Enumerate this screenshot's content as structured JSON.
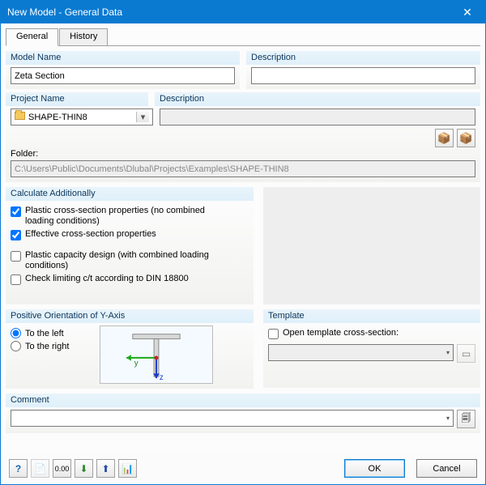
{
  "window": {
    "title": "New Model - General Data"
  },
  "tabs": {
    "general": "General",
    "history": "History"
  },
  "model": {
    "name_label": "Model Name",
    "name_value": "Zeta Section",
    "desc_label": "Description",
    "desc_value": ""
  },
  "project": {
    "name_label": "Project Name",
    "name_value": "SHAPE-THIN8",
    "desc_label": "Description",
    "desc_value": "",
    "folder_label": "Folder:",
    "folder_value": "C:\\Users\\Public\\Documents\\Dlubal\\Projects\\Examples\\SHAPE-THIN8"
  },
  "calc": {
    "header": "Calculate Additionally",
    "opt1": "Plastic cross-section properties (no combined loading conditions)",
    "opt2": "Effective cross-section properties",
    "opt3": "Plastic capacity design (with combined loading conditions)",
    "opt4": "Check limiting c/t according to DIN 18800"
  },
  "axis": {
    "header": "Positive Orientation of Y-Axis",
    "left": "To the left",
    "right": "To the right",
    "y": "y",
    "z": "z"
  },
  "template": {
    "header": "Template",
    "open": "Open template cross-section:"
  },
  "comment": {
    "header": "Comment",
    "value": ""
  },
  "buttons": {
    "ok": "OK",
    "cancel": "Cancel"
  }
}
